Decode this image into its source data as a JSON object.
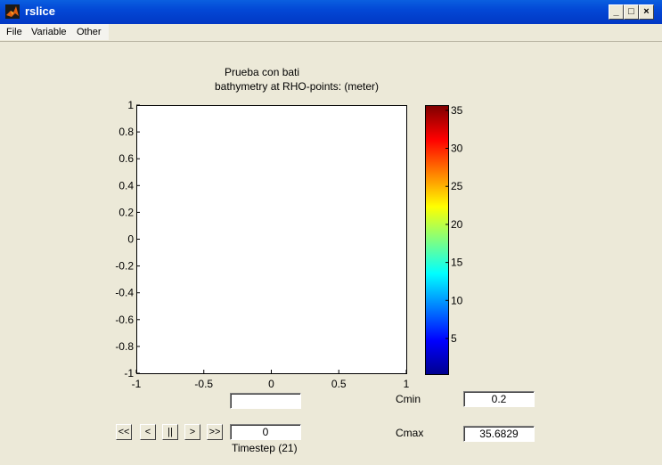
{
  "window": {
    "title": "rslice"
  },
  "window_controls": {
    "minimize": "_",
    "restore": "□",
    "close": "×"
  },
  "menu": {
    "items": [
      "File",
      "Variable",
      "Other"
    ]
  },
  "plot": {
    "title_line1": "Prueba con bati",
    "title_line2": "bathymetry at RHO-points: (meter)"
  },
  "axes": {
    "x_ticks": [
      "-1",
      "-0.5",
      "0",
      "0.5",
      "1"
    ],
    "y_ticks": [
      "1",
      "0.8",
      "0.6",
      "0.4",
      "0.2",
      "0",
      "-0.2",
      "-0.4",
      "-0.6",
      "-0.8",
      "-1"
    ]
  },
  "colorbar": {
    "ticks": [
      "35",
      "30",
      "25",
      "20",
      "15",
      "10",
      "5"
    ],
    "tick_values": [
      35,
      30,
      25,
      20,
      15,
      10,
      5
    ],
    "min": 0.2,
    "max": 35.6829,
    "colormap": "jet"
  },
  "controls": {
    "slider_value": "",
    "cmin_label": "Cmin",
    "cmin_value": "0.2",
    "cmax_label": "Cmax",
    "cmax_value": "35.6829",
    "timestep_value": "0",
    "timestep_label": "Timestep (21)",
    "nav_buttons": [
      "<<",
      "<",
      "||",
      ">",
      ">>"
    ]
  }
}
